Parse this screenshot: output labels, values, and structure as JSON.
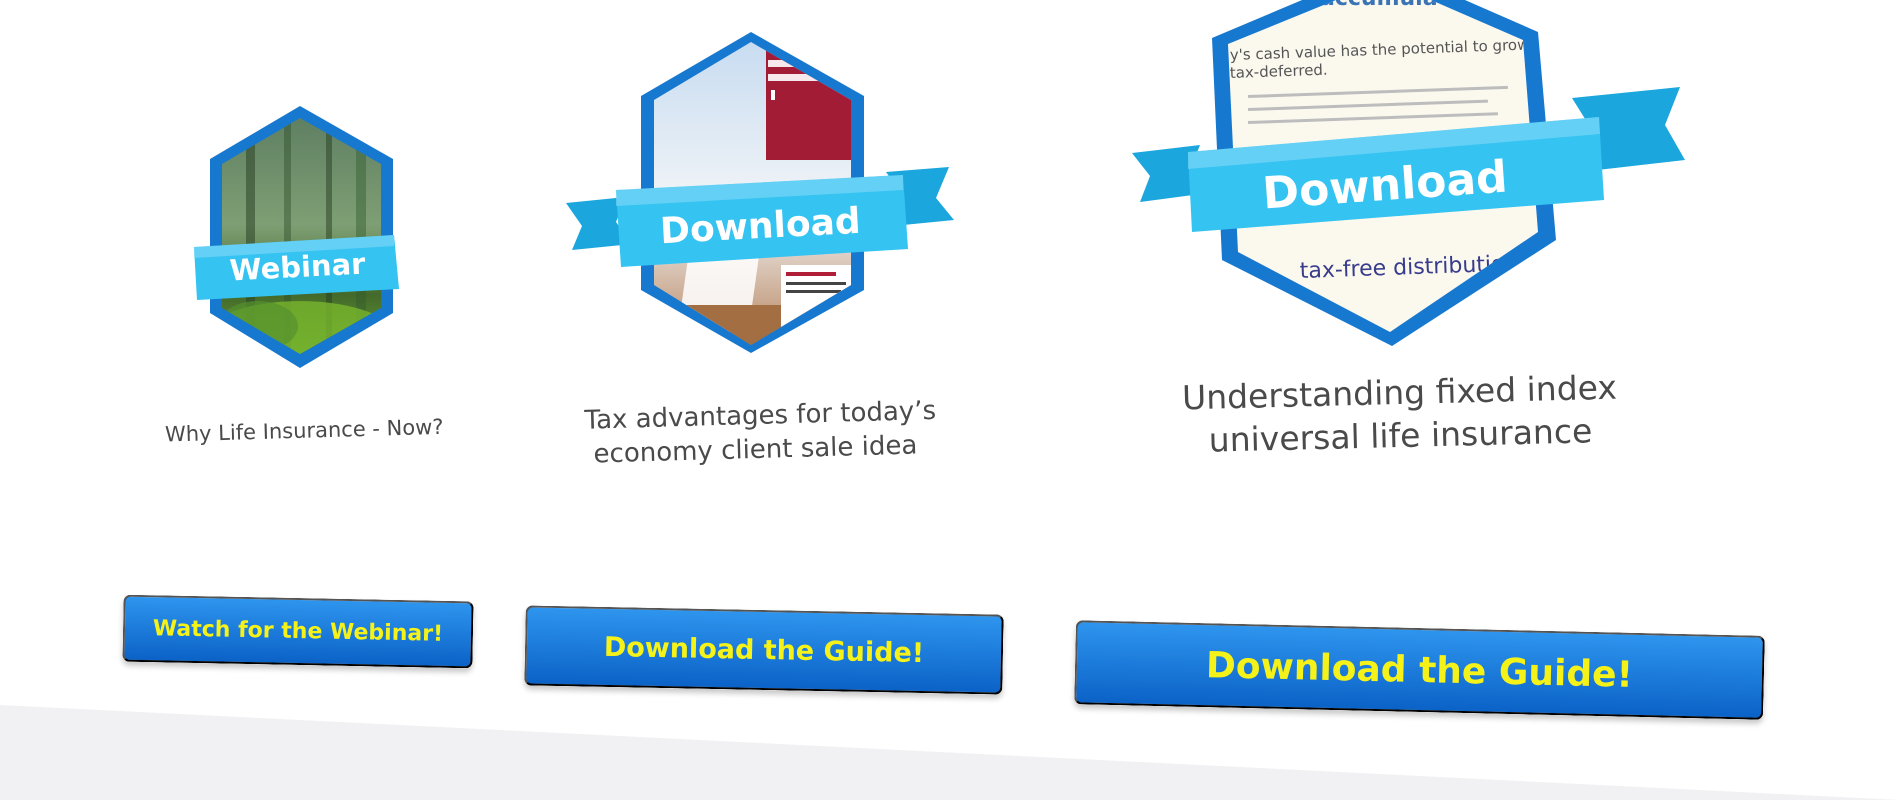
{
  "items": [
    {
      "ribbon": "Webinar",
      "caption": [
        "Why Life Insurance - Now?"
      ],
      "cta": "Watch for the Webinar!"
    },
    {
      "ribbon": "Download",
      "caption": [
        "Tax advantages for today’s",
        "economy client sale idea"
      ],
      "cta": "Download the Guide!"
    },
    {
      "ribbon": "Download",
      "caption": [
        "Understanding fixed index",
        "universal life insurance"
      ],
      "cta": "Download the Guide!",
      "preview": {
        "heading": "accumulation",
        "line1": "y's cash value has the potential to grow",
        "line2": "tax-deferred.",
        "bottom": "tax-free distributio"
      }
    }
  ],
  "colors": {
    "hex_border": "#1778cf",
    "ribbon": "#35c3f2",
    "ribbon_dark": "#1ba6de",
    "button_top": "#2e95ee",
    "button_bottom": "#0b62c7",
    "button_text": "#f5f21a"
  }
}
